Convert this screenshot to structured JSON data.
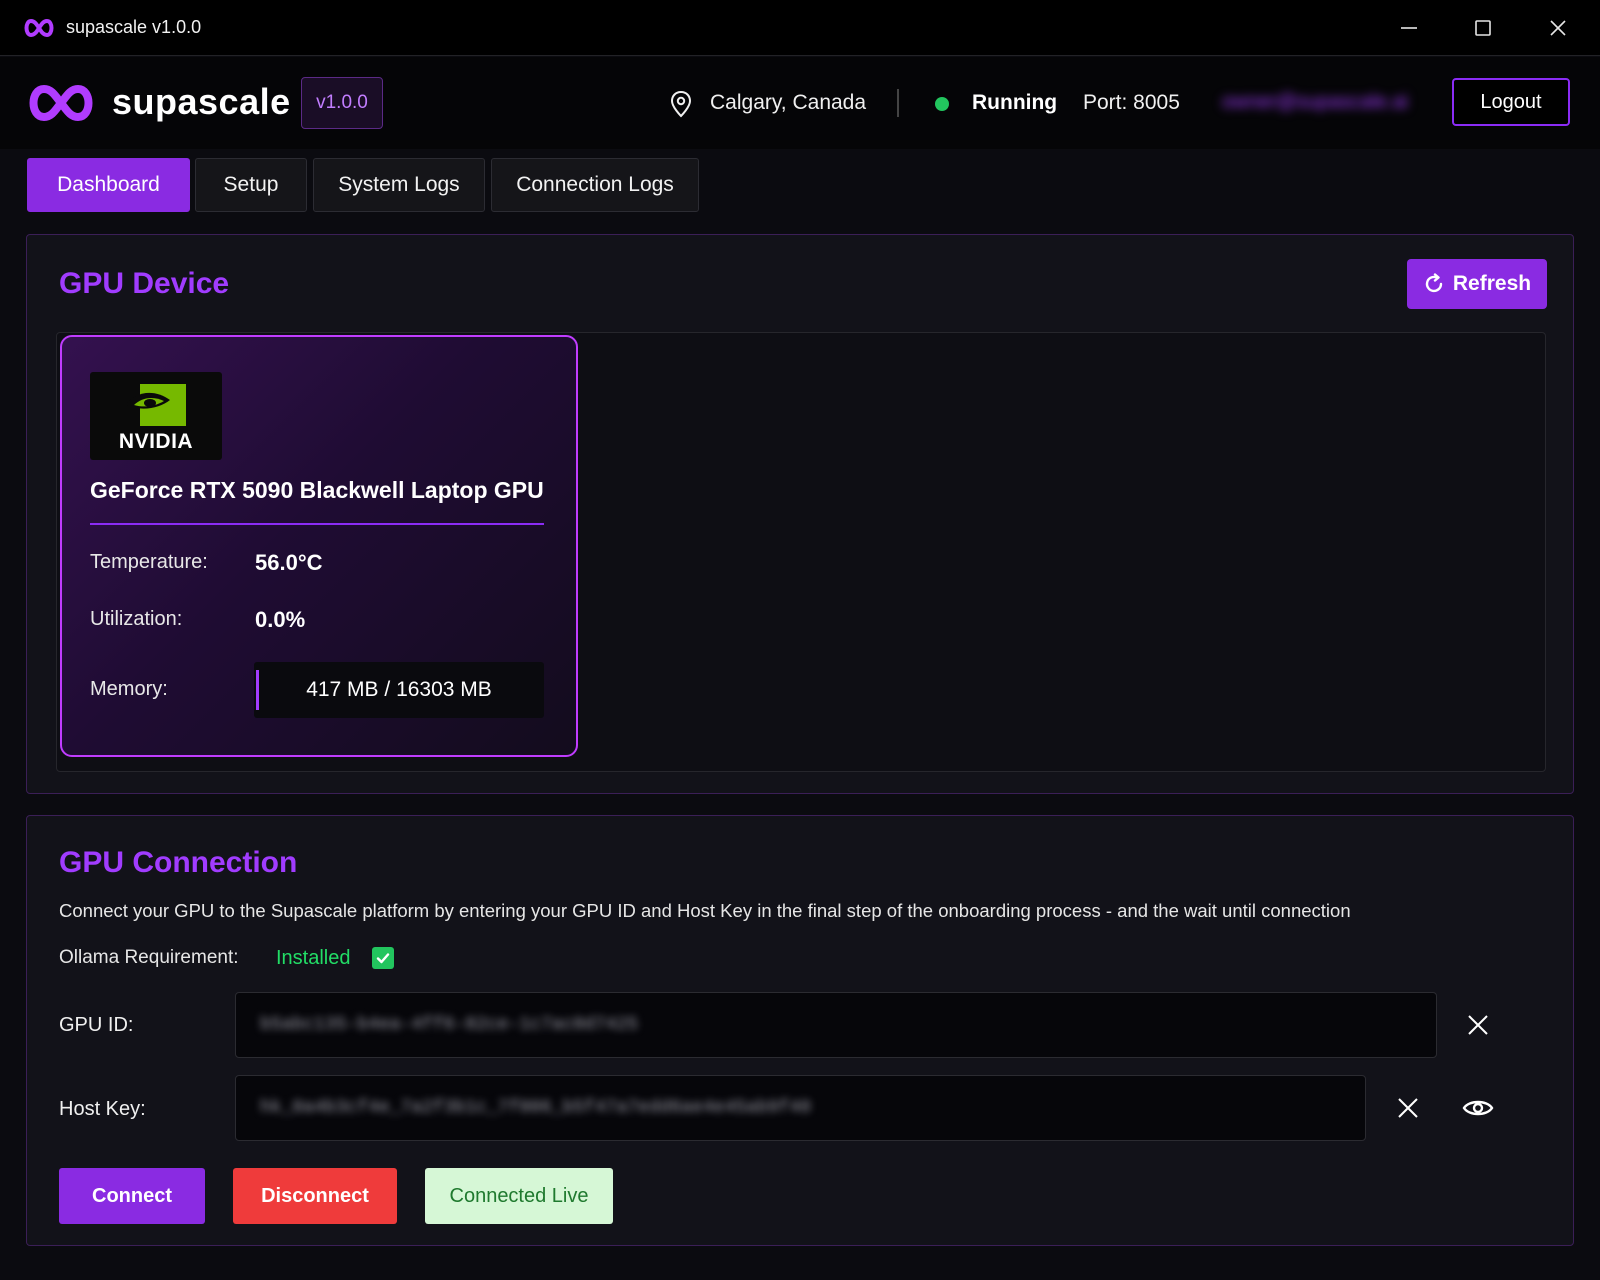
{
  "window": {
    "title": "supascale v1.0.0"
  },
  "header": {
    "brand": "supascale",
    "version": "v1.0.0",
    "location": "Calgary, Canada",
    "status": "Running",
    "port": "Port: 8005",
    "email": "owner@supascale.ai",
    "logout_label": "Logout",
    "status_color": "#22c55e",
    "accent_color": "#8a2be2"
  },
  "tabs": [
    {
      "label": "Dashboard",
      "active": true
    },
    {
      "label": "Setup",
      "active": false
    },
    {
      "label": "System Logs",
      "active": false
    },
    {
      "label": "Connection Logs",
      "active": false
    }
  ],
  "gpu_device": {
    "title": "GPU Device",
    "refresh_label": "Refresh",
    "vendor_logo_text": "NVIDIA",
    "gpu_name": "GeForce RTX 5090 Blackwell Laptop GPU",
    "temperature_label": "Temperature:",
    "temperature_value": "56.0°C",
    "utilization_label": "Utilization:",
    "utilization_value": "0.0%",
    "memory_label": "Memory:",
    "memory_value": "417 MB / 16303 MB",
    "memory_used_fraction": 0.0256
  },
  "gpu_connection": {
    "title": "GPU Connection",
    "description": "Connect your GPU to the Supascale platform by entering your GPU ID and Host Key in the final step of the onboarding process - and the wait until connection",
    "ollama_label": "Ollama Requirement:",
    "ollama_status": "Installed",
    "gpu_id_label": "GPU ID:",
    "gpu_id_value": "b5abc135-b4ea-4ff6-82ce-1c7ac0d7425",
    "host_key_label": "Host Key:",
    "host_key_value": "hk_0a4b3cf4e_7a2f3b1c_7f006_b5f47a7edd6ae4e45ab9f40",
    "connect_label": "Connect",
    "disconnect_label": "Disconnect",
    "status_label": "Connected Live"
  }
}
